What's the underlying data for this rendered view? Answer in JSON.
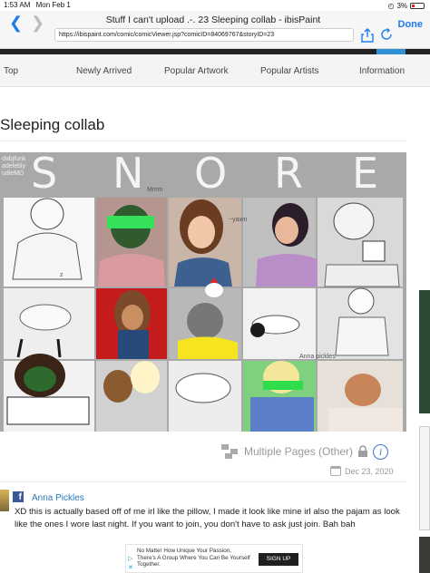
{
  "status": {
    "time": "1:53 AM",
    "date": "Mon Feb 1",
    "battery": "3%"
  },
  "browser": {
    "title": "Stuff I can't upload .-. 23 Sleeping collab - ibisPaint",
    "url": "https://ibispaint.com/comic/comicViewer.jsp?comicID=84069767&storyID=23",
    "done": "Done"
  },
  "sitenav": {
    "items": [
      "Top",
      "Newly Arrived",
      "Popular Artwork",
      "Popular Artists",
      "Information"
    ]
  },
  "article": {
    "title": "Sleeping collab"
  },
  "artwork": {
    "letters": [
      "S",
      "N",
      "O",
      "R",
      "E"
    ],
    "corner_tag": "dabjfunk\nadelebly\nudleMD",
    "notes": [
      "Mmm",
      "~yawn",
      "z",
      "Anna pickles"
    ]
  },
  "meta": {
    "pages": "Multiple Pages (Other)",
    "date": "Dec 23, 2020"
  },
  "comment": {
    "author": "Anna Pickles",
    "text": "XD this is actually based off of me irl like the pillow, I made it look like mine irl also the pajam as look like the ones I wore last night. If you want to join, you don't have to ask just join. Bah bah"
  },
  "ad": {
    "text": "No Matter How Unique Your Passion, There's A Group Where You Can Be Yourself Together.",
    "cta": "SIGN UP"
  },
  "colors": {
    "accent": "#1d7cf2",
    "link": "#2a7ab8",
    "facebook": "#3b5998",
    "artwork_bg": "#a9a9aa"
  }
}
